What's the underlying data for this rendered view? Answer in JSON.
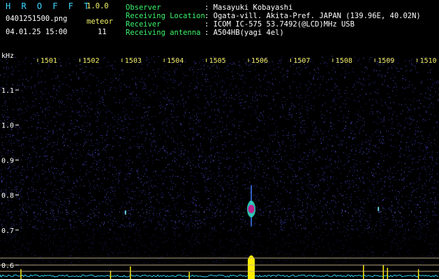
{
  "header": {
    "app_title": "H R O F F T",
    "version": "1.0.0",
    "filename": "0401251500.png",
    "timestamp": "04.01.25 15:00",
    "meteor_label": "meteor",
    "meteor_count": "11",
    "info_labels": [
      "Observer",
      "Receiving Location",
      "Receiver",
      "Receiving antenna"
    ],
    "info_values": [
      ": Masayuki Kobayashi",
      ": Ogata-vill. Akita-Pref. JAPAN (139.96E, 40.02N)",
      ": ICOM IC-575 53.7492(@LCD)MHz USB",
      ": A504HB(yagi 4el)"
    ]
  },
  "plot": {
    "unit_label": "kHz",
    "time_ticks": [
      "1501",
      "1502",
      "1503",
      "1504",
      "1505",
      "1506",
      "1507",
      "1508",
      "1509",
      "1510"
    ],
    "freq_ticks": [
      "1.1",
      "1.0",
      "0.9",
      "0.8",
      "0.7",
      "0.6"
    ],
    "colors": {
      "background": "#000000",
      "noise": "#3a3aa8",
      "tick_text": "#f5f06a",
      "axis_text": "#ffffff",
      "echo_core": "#c0208f",
      "echo_edge": "#35e0c8",
      "spectrum": "#2fd0f0",
      "peak": "#ffee00",
      "reference_lines": "#c8b48c"
    }
  },
  "chart_data": {
    "type": "heatmap",
    "xlabel": "",
    "ylabel": "kHz",
    "x_ticks": [
      "1501",
      "1502",
      "1503",
      "1504",
      "1505",
      "1506",
      "1507",
      "1508",
      "1509",
      "1510"
    ],
    "y_ticks": [
      1.1,
      1.0,
      0.9,
      0.8,
      0.7,
      0.6
    ],
    "events": [
      {
        "time": "1506",
        "freq_khz": 0.76,
        "strength": "strong"
      },
      {
        "time": "1503",
        "freq_khz": 0.75,
        "strength": "weak"
      },
      {
        "time": "1509",
        "freq_khz": 0.76,
        "strength": "weak"
      }
    ]
  }
}
